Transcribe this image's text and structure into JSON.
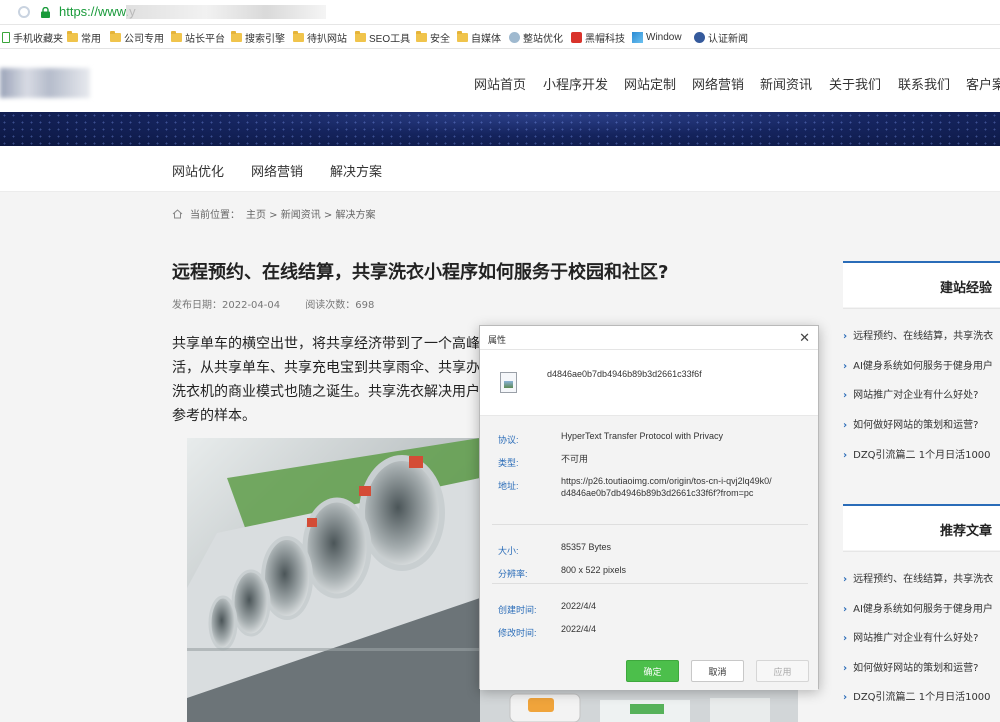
{
  "browser": {
    "url_scheme": "https://www.",
    "url_host": "y",
    "bookmarks": [
      {
        "label": "手机收藏夹",
        "icon": "phone-icon"
      },
      {
        "label": "常用",
        "icon": "folder-icon"
      },
      {
        "label": "公司专用",
        "icon": "folder-icon"
      },
      {
        "label": "站长平台",
        "icon": "folder-icon"
      },
      {
        "label": "搜索引擎",
        "icon": "folder-icon"
      },
      {
        "label": "待扒网站",
        "icon": "folder-icon"
      },
      {
        "label": "SEO工具",
        "icon": "folder-icon"
      },
      {
        "label": "安全",
        "icon": "folder-icon"
      },
      {
        "label": "自媒体",
        "icon": "folder-icon"
      },
      {
        "label": "整站优化",
        "icon": "site-icon"
      },
      {
        "label": "黑帽科技",
        "icon": "site-icon"
      },
      {
        "label": "Window",
        "icon": "windows-icon"
      },
      {
        "label": "认证新闻",
        "icon": "site-icon"
      }
    ]
  },
  "header": {
    "nav": [
      "网站首页",
      "小程序开发",
      "网站定制",
      "网络营销",
      "新闻资讯",
      "关于我们",
      "联系我们",
      "客户案"
    ]
  },
  "subnav": [
    "网站优化",
    "网络营销",
    "解决方案"
  ],
  "breadcrumb": {
    "prefix": "当前位置：",
    "path": "主页 > 新闻资讯 > 解决方案"
  },
  "article": {
    "title": "远程预约、在线结算，共享洗衣小程序如何服务于校园和社区?",
    "publish_date": "发布日期：2022-04-04",
    "views": "阅读次数：698",
    "lines": [
      "共享单车的横空出世，将共享经济带到了一个高峰",
      "活，从共享单车、共享充电宝到共享雨伞、共享办",
      "洗衣机的商业模式也随之诞生。共享洗衣解决用户",
      "参考的样本。"
    ]
  },
  "sidebar": {
    "section1": {
      "title": "建站经验",
      "items": [
        "远程预约、在线结算，共享洗衣",
        "AI健身系统如何服务于健身用户",
        "网站推广对企业有什么好处?",
        "如何做好网站的策划和运营?",
        "DZQ引流篇二 1个月日活1000"
      ]
    },
    "section2": {
      "title": "推荐文章",
      "items": [
        "远程预约、在线结算，共享洗衣",
        "AI健身系统如何服务于健身用户",
        "网站推广对企业有什么好处?",
        "如何做好网站的策划和运营?",
        "DZQ引流篇二 1个月日活1000"
      ]
    }
  },
  "dialog": {
    "title": "属性",
    "file_name": "d4846ae0b7db4946b89b3d2661c33f6f",
    "fields": [
      {
        "label": "协议:",
        "value": "HyperText Transfer Protocol with Privacy"
      },
      {
        "label": "类型:",
        "value": "不可用"
      },
      {
        "label": "地址:",
        "value_line1": "https://p26.toutiaoimg.com/origin/tos-cn-i-qvj2lq49k0/",
        "value_line2": "d4846ae0b7db4946b89b3d2661c33f6f?from=pc"
      },
      {
        "label": "大小:",
        "value": "85357 Bytes"
      },
      {
        "label": "分辨率:",
        "value": "800 x 522 pixels"
      },
      {
        "label": "创建时间:",
        "value": "2022/4/4"
      },
      {
        "label": "修改时间:",
        "value": "2022/4/4"
      }
    ],
    "buttons": {
      "ok": "确定",
      "cancel": "取消",
      "apply": "应用"
    }
  }
}
